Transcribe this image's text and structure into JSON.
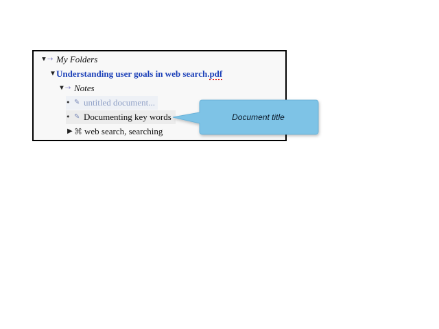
{
  "tree": {
    "root": {
      "label": "My Folders",
      "toggle": "▼",
      "icon": "link-arrow-icon"
    },
    "document": {
      "toggle": "▼",
      "label": "Understanding user goals in web search.",
      "ext": "pdf"
    },
    "notes_folder": {
      "toggle": "▼",
      "label": "Notes",
      "icon": "link-arrow-icon"
    },
    "notes": [
      {
        "bullet": "•",
        "icon": "pencil-icon",
        "label": "untitled document..."
      },
      {
        "bullet": "•",
        "icon": "pencil-icon",
        "label": "Documenting key words"
      }
    ],
    "keywords": {
      "toggle": "▶",
      "icon": "command-icon",
      "label": "web search, searching"
    }
  },
  "callout": {
    "text": "Document title",
    "fill": "#7ec3e6"
  }
}
